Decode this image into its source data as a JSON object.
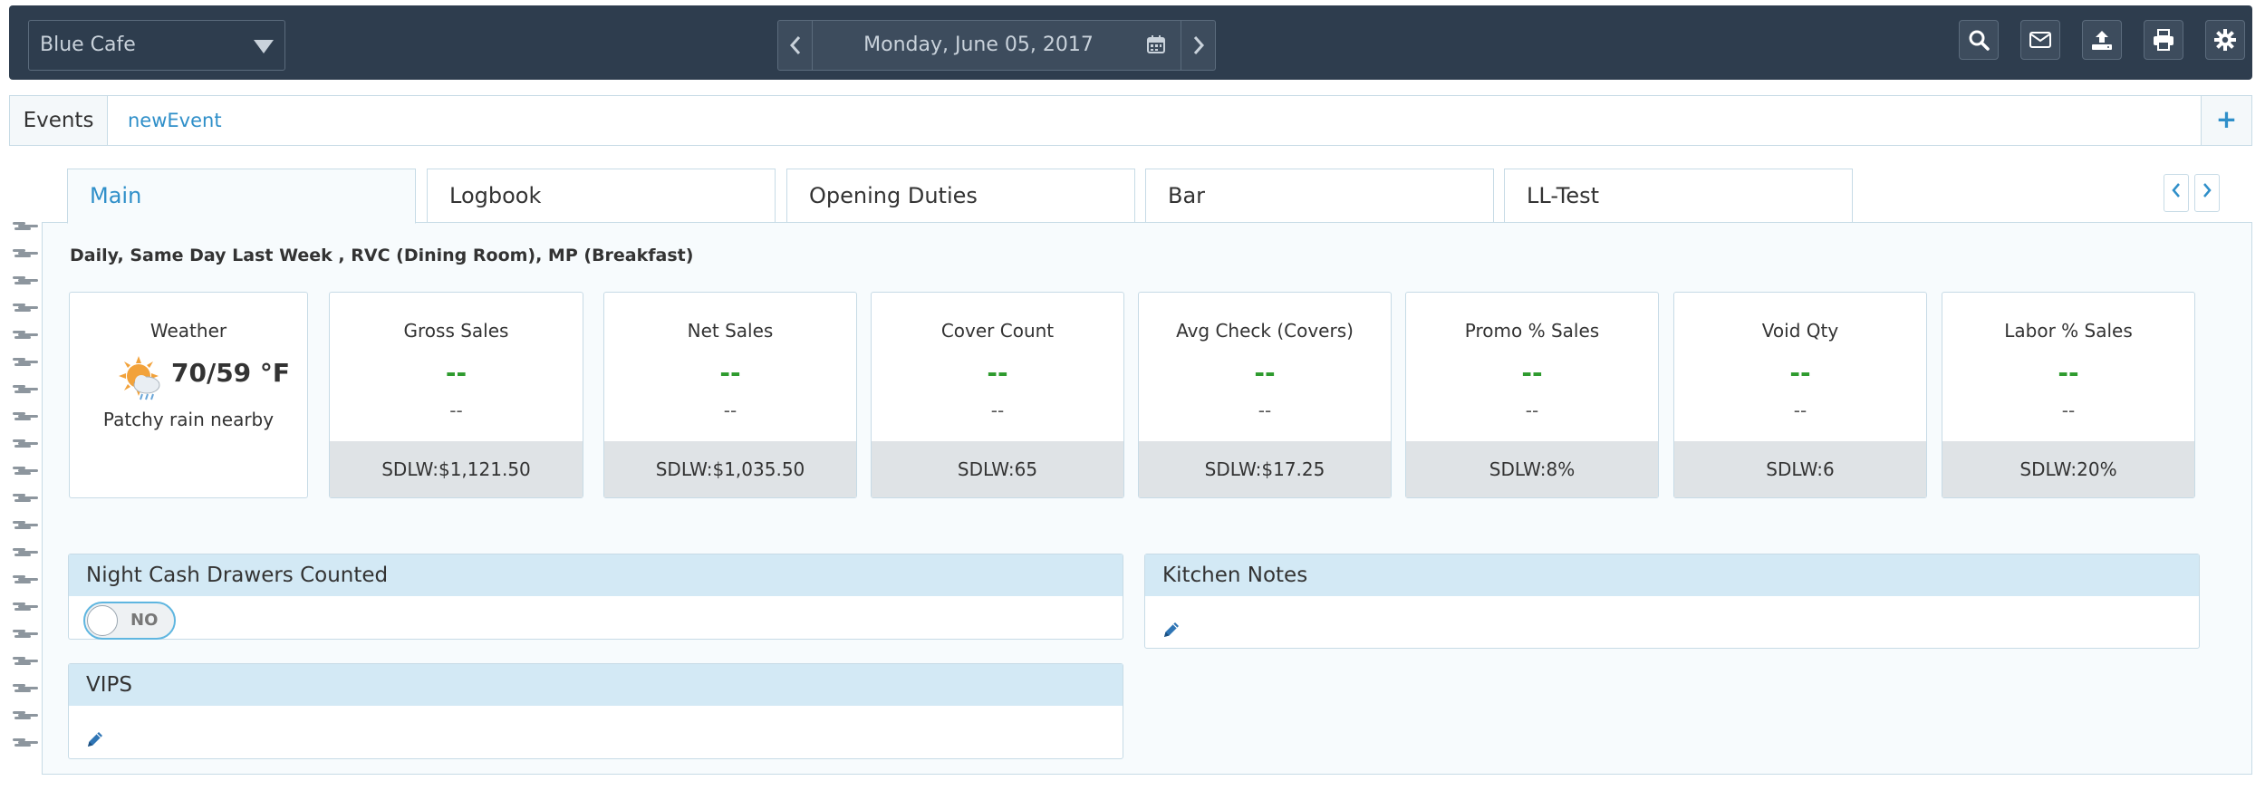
{
  "topbar": {
    "venue": "Blue Cafe",
    "date": "Monday, June 05, 2017",
    "prev_icon": "chevron-left-icon",
    "next_icon": "chevron-right-icon",
    "actions": [
      "search-icon",
      "envelope-icon",
      "upload-icon",
      "print-icon",
      "gear-icon"
    ]
  },
  "events": {
    "label": "Events",
    "items": [
      "newEvent"
    ],
    "add_label": "+"
  },
  "tabs": [
    "Main",
    "Logbook",
    "Opening Duties",
    "Bar",
    "LL-Test"
  ],
  "main": {
    "filters": "Daily, Same Day Last Week , RVC (Dining Room), MP (Breakfast)",
    "weather": {
      "title": "Weather",
      "temp": "70/59 °F",
      "desc": "Patchy rain nearby",
      "icon": "sun-cloud-rain-icon"
    },
    "kpis": [
      {
        "title": "Gross Sales",
        "value": "--",
        "sub": "--",
        "foot": "SDLW:$1,121.50"
      },
      {
        "title": "Net Sales",
        "value": "--",
        "sub": "--",
        "foot": "SDLW:$1,035.50"
      },
      {
        "title": "Cover Count",
        "value": "--",
        "sub": "--",
        "foot": "SDLW:65"
      },
      {
        "title": "Avg Check (Covers)",
        "value": "--",
        "sub": "--",
        "foot": "SDLW:$17.25"
      },
      {
        "title": "Promo % Sales",
        "value": "--",
        "sub": "--",
        "foot": "SDLW:8%"
      },
      {
        "title": "Void Qty",
        "value": "--",
        "sub": "--",
        "foot": "SDLW:6"
      },
      {
        "title": "Labor % Sales",
        "value": "--",
        "sub": "--",
        "foot": "SDLW:20%"
      }
    ],
    "night_cash": {
      "title": "Night Cash Drawers Counted",
      "toggle": "NO"
    },
    "kitchen_notes": {
      "title": "Kitchen Notes"
    },
    "vips": {
      "title": "VIPS"
    }
  },
  "colors": {
    "topbar": "#2e3d4e",
    "accent": "#2f8fc9",
    "kpi_value": "#2e9b2e",
    "card_header": "#d3e9f5"
  }
}
